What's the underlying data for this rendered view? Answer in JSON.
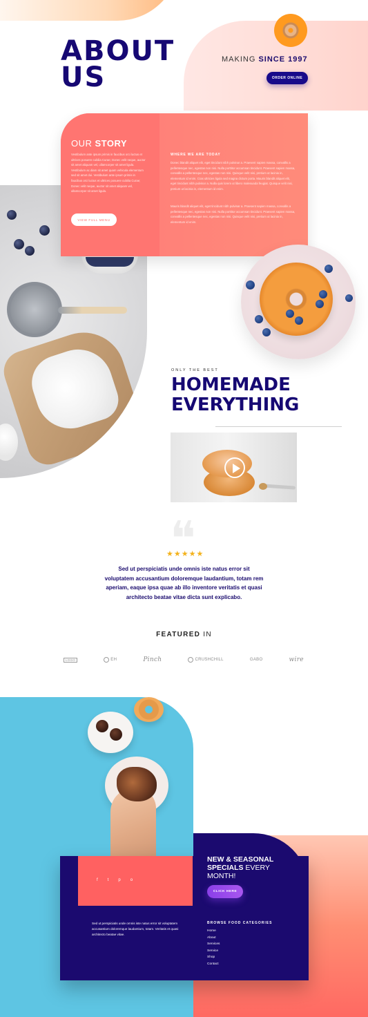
{
  "hero": {
    "title": "ABOUT\nUS",
    "tagline_pre": "MAKING ",
    "tagline_bold": "SINCE 1997",
    "order_button": "ORDER ONLINE"
  },
  "story": {
    "heading_light": "OUR ",
    "heading_bold": "STORY",
    "text": "Vestibulum ante ipsum primis in faucibus orci luctus et ultrices posuere cubilia Curae; Donec velit neque, auctor sit amet aliquam vel, ullamcorper sit amet ligula. Vestibulum ac diam sit amet quam vehicula elementum sed sit amet dui. Vestibulum ante ipsum primis in faucibus orci luctus et ultrices posuere cubilia Curae; Donec velit neque, auctor sit amet aliquam vel, ullamcorper sit amet ligula.",
    "button": "VIEW FULL MENU",
    "where_heading": "WHERE WE ARE TODAY",
    "where_text_1": "Donec blandit aliquet elit, eget tincidunt nibh pulvinar a. Praesent sapien massa, convallis a pellentesque nec, egestas non nisi. Nulla porttitor accumsan tincidunt. Praesent sapien massa, convallis a pellentesque nec, egestas non nisi. Quisque velit nisi, pretium ut lacinia in, elementum id enim. Cras ultricies ligula sed magna dictum porta. Mauris blandit aliquet elit, eget tincidunt nibh pulvinar a. Nulla quis lorem ut libero malesuada feugiat. Quisque velit nisi, pretium ut lacinia in, elementum id enim.",
    "where_text_2": "Mauris blandit aliquet elit, eget tincidunt nibh pulvinar a. Praesent sapien massa, convallis a pellentesque nec, egestas non nisi. Nulla porttitor accumsan tincidunt. Praesent sapien massa, convallis a pellentesque nec, egestas non nisi. Quisque velit nisi, pretium ut lacinia in, elementum id enim."
  },
  "homemade": {
    "kicker": "ONLY THE BEST",
    "title": "HOMEMADE\nEVERYTHING"
  },
  "testimonial": {
    "stars": "★★★★★",
    "text": "Sed ut perspiciatis unde omnis iste natus error sit voluptatem accusantium doloremque laudantium, totam rem aperiam, eaque ipsa quae ab illo inventore veritatis et quasi architecto beatae vitae dicta sunt explicabo."
  },
  "featured": {
    "heading_bold": "FEATURED",
    "heading_light": " IN",
    "logos": [
      "LOGO",
      "EH",
      "Pinch",
      "CRUSHCHILL",
      "GABO",
      "wire"
    ]
  },
  "footer": {
    "social": [
      "f",
      "t",
      "p",
      "o"
    ],
    "text": "Sed ut perspiciatis unde omnis iste natus error sit voluptatem accusantium doloremque laudantium, totam. Veritatis et quasi architecto beatae vitae.",
    "seasonal_bold": "NEW & SEASONAL SPECIALS",
    "seasonal_light": " EVERY MONTH!",
    "click_button": "CLICK HERE",
    "categories_heading": "BROWSE FOOD CATEGORIES",
    "categories": [
      "Home",
      "About",
      "Services",
      "Service",
      "Shop",
      "Contact"
    ]
  }
}
